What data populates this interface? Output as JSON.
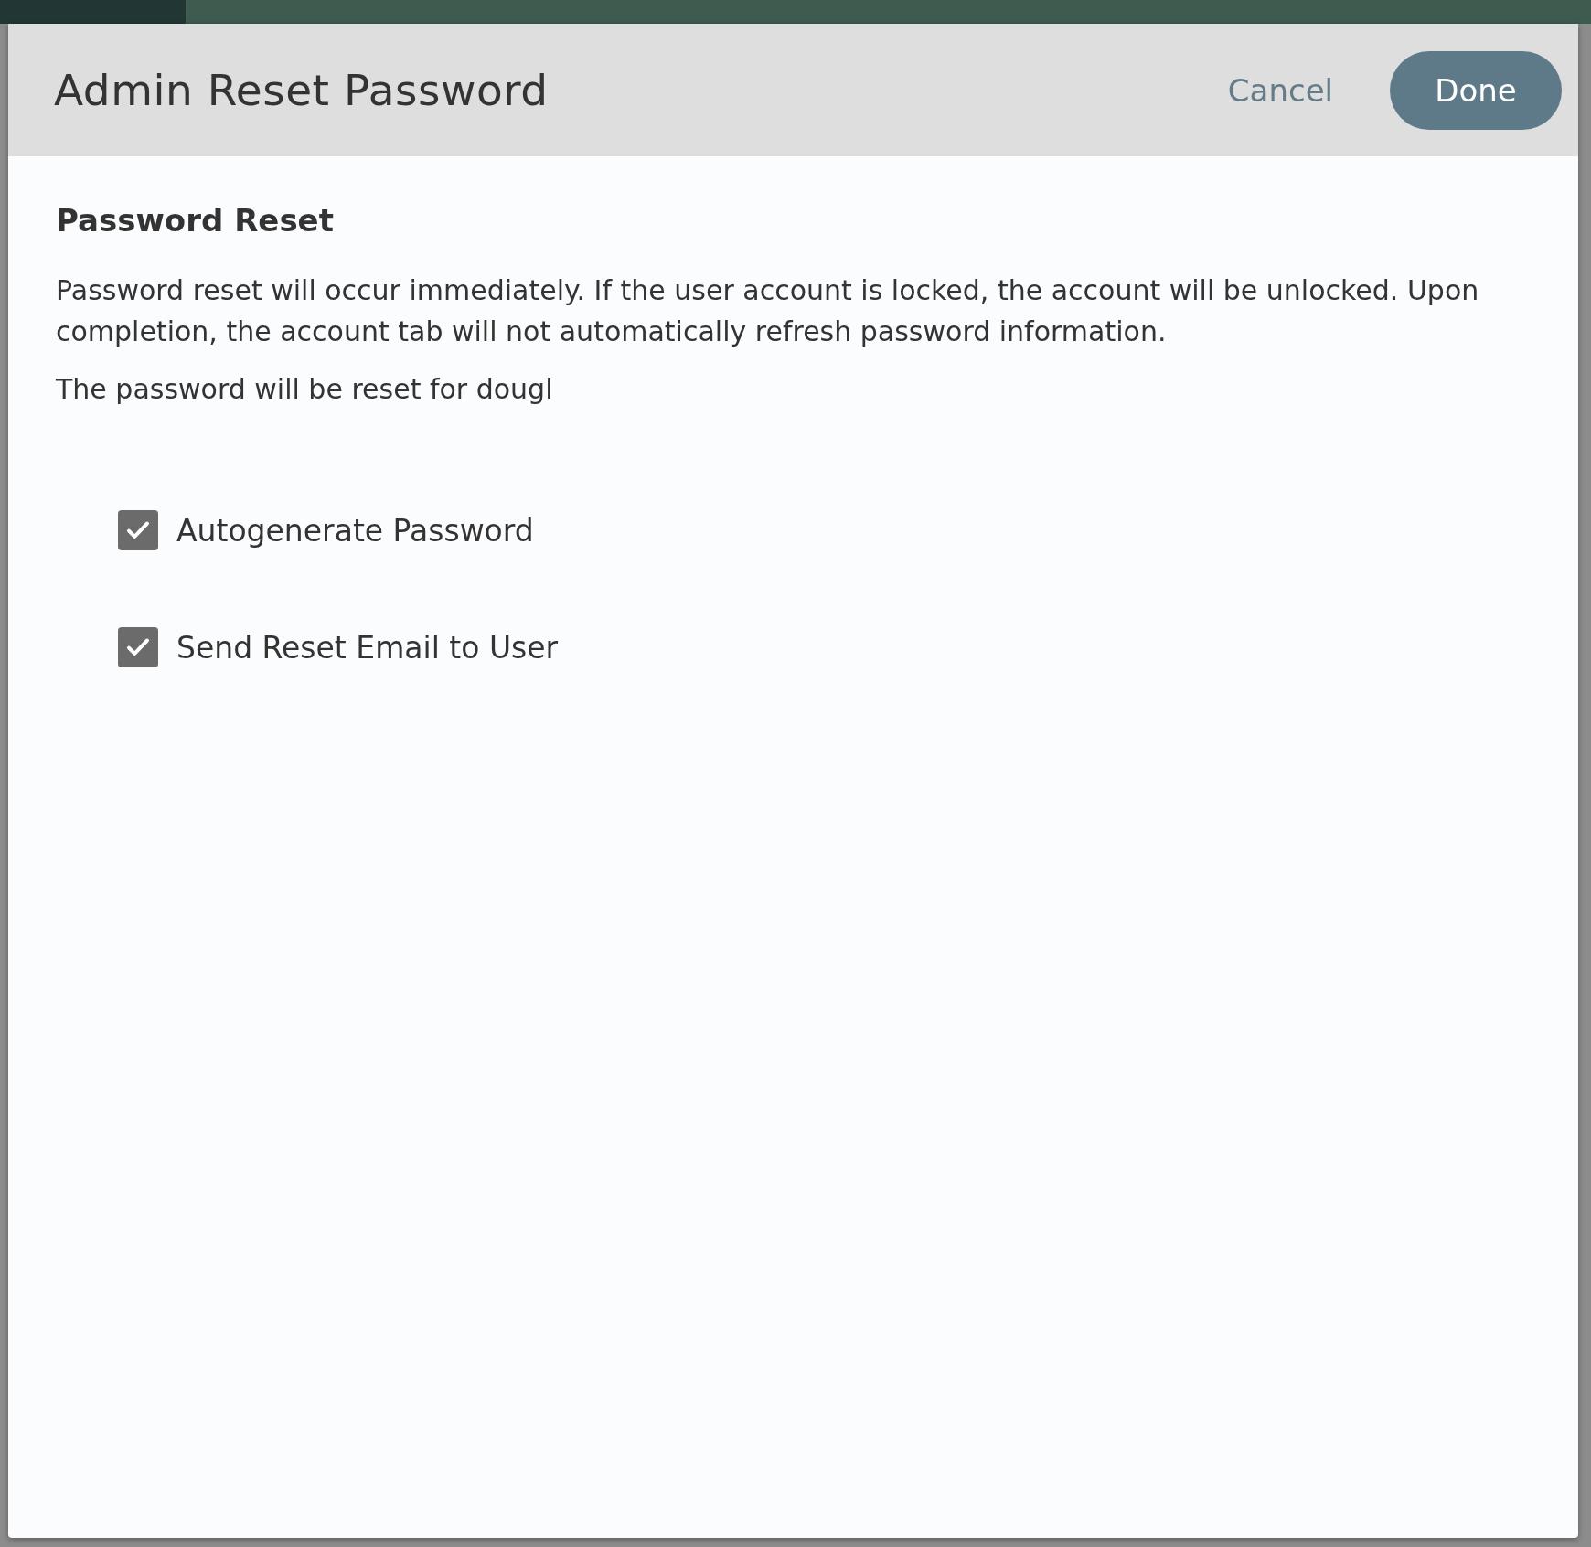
{
  "dialog": {
    "title": "Admin Reset Password",
    "actions": [
      {
        "kind": "secondary",
        "label": "Cancel"
      },
      {
        "kind": "primary",
        "label": "Done"
      }
    ],
    "section_title": "Password Reset",
    "description": "Password reset will occur immediately. If the user account is locked, the account will be unlocked. Upon completion, the account tab will not automatically refresh password information.",
    "target_text": "The password will be reset for dougl",
    "options": [
      {
        "label": "Autogenerate Password",
        "checked": true
      },
      {
        "label": "Send Reset Email to User",
        "checked": true
      }
    ]
  }
}
